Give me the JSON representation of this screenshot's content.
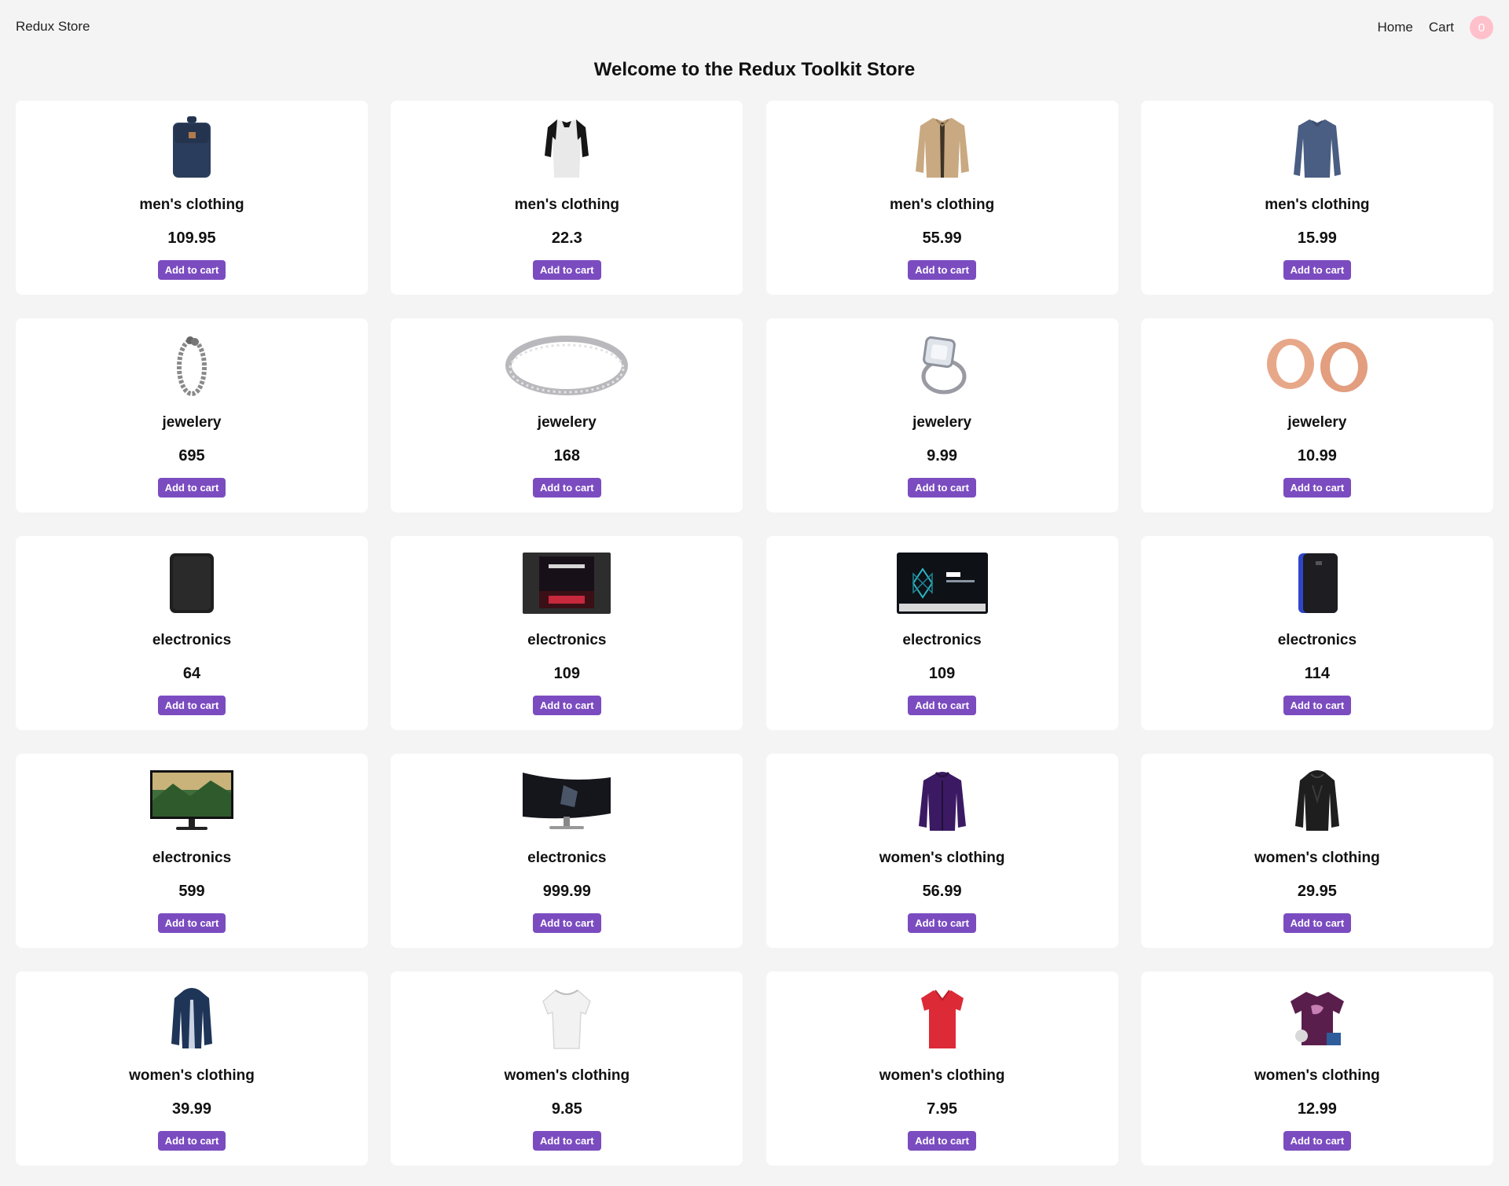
{
  "header": {
    "brand": "Redux Store",
    "nav": {
      "home": "Home",
      "cart": "Cart"
    },
    "cart_count": "0"
  },
  "page_title": "Welcome to the Redux Toolkit Store",
  "products": [
    {
      "category": "men's clothing",
      "price": "109.95",
      "button": "Add to cart",
      "icon": "backpack-image"
    },
    {
      "category": "men's clothing",
      "price": "22.3",
      "button": "Add to cart",
      "icon": "tshirt-image"
    },
    {
      "category": "men's clothing",
      "price": "55.99",
      "button": "Add to cart",
      "icon": "jacket-image"
    },
    {
      "category": "men's clothing",
      "price": "15.99",
      "button": "Add to cart",
      "icon": "longsleeve-image"
    },
    {
      "category": "jewelery",
      "price": "695",
      "button": "Add to cart",
      "icon": "bracelet-image"
    },
    {
      "category": "jewelery",
      "price": "168",
      "button": "Add to cart",
      "icon": "ring-band-image"
    },
    {
      "category": "jewelery",
      "price": "9.99",
      "button": "Add to cart",
      "icon": "diamond-ring-image"
    },
    {
      "category": "jewelery",
      "price": "10.99",
      "button": "Add to cart",
      "icon": "rose-gold-plugs-image"
    },
    {
      "category": "electronics",
      "price": "64",
      "button": "Add to cart",
      "icon": "hard-drive-image"
    },
    {
      "category": "electronics",
      "price": "109",
      "button": "Add to cart",
      "icon": "ssd-image"
    },
    {
      "category": "electronics",
      "price": "109",
      "button": "Add to cart",
      "icon": "ssd-image"
    },
    {
      "category": "electronics",
      "price": "114",
      "button": "Add to cart",
      "icon": "portable-drive-image"
    },
    {
      "category": "electronics",
      "price": "599",
      "button": "Add to cart",
      "icon": "monitor-image"
    },
    {
      "category": "electronics",
      "price": "999.99",
      "button": "Add to cart",
      "icon": "curved-monitor-image"
    },
    {
      "category": "women's clothing",
      "price": "56.99",
      "button": "Add to cart",
      "icon": "purple-jacket-image"
    },
    {
      "category": "women's clothing",
      "price": "29.95",
      "button": "Add to cart",
      "icon": "leather-jacket-image"
    },
    {
      "category": "women's clothing",
      "price": "39.99",
      "button": "Add to cart",
      "icon": "raincoat-image"
    },
    {
      "category": "women's clothing",
      "price": "9.85",
      "button": "Add to cart",
      "icon": "white-top-image"
    },
    {
      "category": "women's clothing",
      "price": "7.95",
      "button": "Add to cart",
      "icon": "red-tshirt-image"
    },
    {
      "category": "women's clothing",
      "price": "12.99",
      "button": "Add to cart",
      "icon": "purple-tshirt-image"
    }
  ],
  "colors": {
    "accent": "#7b4cc0",
    "badge": "#ffc0cb",
    "background": "#f4f4f4",
    "card": "#ffffff"
  }
}
